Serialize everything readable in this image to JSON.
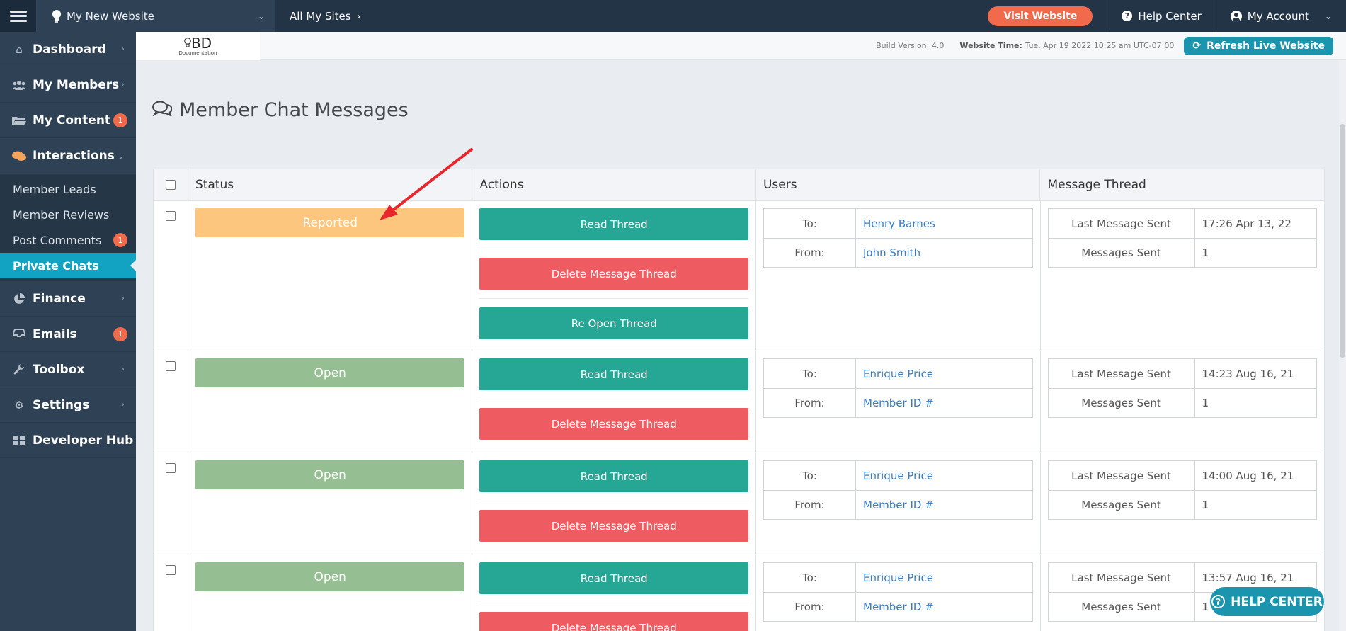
{
  "topbar": {
    "site_name": "My New Website",
    "all_sites": "All My Sites",
    "visit_website": "Visit Website",
    "help_center": "Help Center",
    "my_account": "My Account"
  },
  "sidebar": {
    "items": [
      {
        "label": "Dashboard",
        "icon": "home-icon"
      },
      {
        "label": "My Members",
        "icon": "users-icon"
      },
      {
        "label": "My Content",
        "icon": "folder-icon",
        "badge": "1"
      },
      {
        "label": "Interactions",
        "icon": "chat-icon"
      },
      {
        "label": "Finance",
        "icon": "pie-chart-icon"
      },
      {
        "label": "Emails",
        "icon": "inbox-icon",
        "badge": "1"
      },
      {
        "label": "Toolbox",
        "icon": "wrench-icon"
      },
      {
        "label": "Settings",
        "icon": "gear-icon"
      },
      {
        "label": "Developer Hub",
        "icon": "grid-icon"
      }
    ],
    "interactions_sub": [
      {
        "label": "Member Leads"
      },
      {
        "label": "Member Reviews"
      },
      {
        "label": "Post Comments",
        "badge": "1"
      },
      {
        "label": "Private Chats"
      }
    ]
  },
  "subheader": {
    "logo_text": "BD",
    "logo_sub": "Documentation",
    "build_version": "Build Version: 4.0",
    "website_time_label": "Website Time:",
    "website_time_value": "Tue, Apr 19 2022 10:25 am UTC-07:00",
    "refresh_label": "Refresh Live Website"
  },
  "page": {
    "title": "Member Chat Messages"
  },
  "table": {
    "headers": [
      "Status",
      "Actions",
      "Users",
      "Message Thread"
    ],
    "labels": {
      "read_thread": "Read Thread",
      "delete_thread": "Delete Message Thread",
      "reopen_thread": "Re Open Thread",
      "to": "To:",
      "from": "From:",
      "last_message_sent": "Last Message Sent",
      "messages_sent": "Messages Sent"
    },
    "rows": [
      {
        "status": "Reported",
        "to": "Henry Barnes",
        "from": "John Smith",
        "last_sent": "17:26 Apr 13, 22",
        "count": "1"
      },
      {
        "status": "Open",
        "to": "Enrique Price",
        "from": "Member ID #",
        "last_sent": "14:23 Aug 16, 21",
        "count": "1"
      },
      {
        "status": "Open",
        "to": "Enrique Price",
        "from": "Member ID #",
        "last_sent": "14:00 Aug 16, 21",
        "count": "1"
      },
      {
        "status": "Open",
        "to": "Enrique Price",
        "from": "Member ID #",
        "last_sent": "13:57 Aug 16, 21",
        "count": "1"
      }
    ]
  },
  "float_help": {
    "label": "HELP CENTER"
  },
  "colors": {
    "topbar": "#233446",
    "sidebar": "#2f4255",
    "accent": "#12a3c3",
    "visit": "#f16a4b",
    "reported": "#fdc67e",
    "open": "#96be93",
    "teal": "#26a694",
    "red": "#ee5b61",
    "annotation_arrow": "#e8262b"
  }
}
